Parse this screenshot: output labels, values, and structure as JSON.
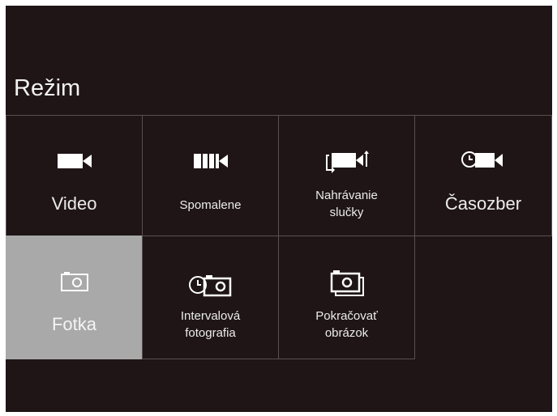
{
  "screen": {
    "title": "Režim"
  },
  "modes": [
    {
      "line1": "Video",
      "line2": "",
      "icon": "video-camera-icon",
      "selected": false
    },
    {
      "line1": "Spomalene",
      "line2": "",
      "icon": "slow-motion-icon",
      "selected": false
    },
    {
      "line1": "Nahrávanie",
      "line2": "slučky",
      "icon": "loop-recording-icon",
      "selected": false
    },
    {
      "line1": "Časozber",
      "line2": "",
      "icon": "timelapse-icon",
      "selected": false
    },
    {
      "line1": "Fotka",
      "line2": "",
      "icon": "photo-camera-icon",
      "selected": true
    },
    {
      "line1": "Intervalová",
      "line2": "fotografia",
      "icon": "interval-photo-icon",
      "selected": false
    },
    {
      "line1": "Pokračovať",
      "line2": "obrázok",
      "icon": "burst-photo-icon",
      "selected": false
    }
  ],
  "colors": {
    "background": "#1f1516",
    "selected_tile": "#a9a9a9",
    "grid_line": "#5a5050",
    "text": "#ececec"
  }
}
